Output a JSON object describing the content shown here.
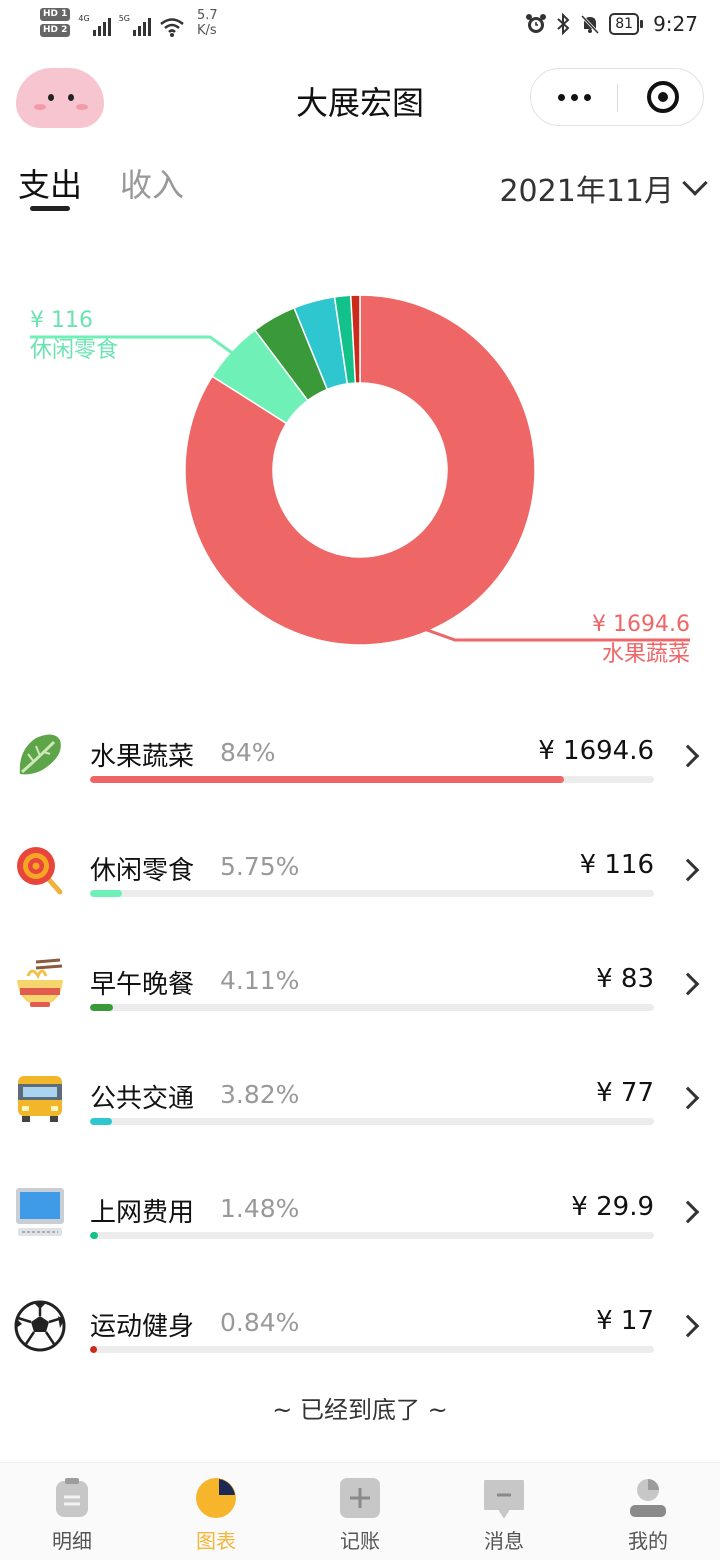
{
  "status_bar": {
    "sim1": "HD 1",
    "sim2": "HD 2",
    "net1": "4G",
    "net2": "5G",
    "speed_value": "5.7",
    "speed_unit": "K/s",
    "battery": "81",
    "time": "9:27"
  },
  "header": {
    "title": "大展宏图"
  },
  "tabs": [
    {
      "label": "支出",
      "active": true
    },
    {
      "label": "收入",
      "active": false
    }
  ],
  "month": "2021年11月",
  "chart_data": {
    "type": "pie",
    "style": "donut",
    "categories": [
      "水果蔬菜",
      "休闲零食",
      "早午晚餐",
      "公共交通",
      "上网费用",
      "运动健身"
    ],
    "values": [
      1694.6,
      116,
      83,
      77,
      29.9,
      17
    ],
    "colors": [
      "#ee6666",
      "#6ff0b6",
      "#3a9a3a",
      "#2ec7cf",
      "#12c28a",
      "#cc2a1a"
    ],
    "callouts": [
      {
        "amount": "¥ 116",
        "label": "休闲零食"
      },
      {
        "amount": "¥ 1694.6",
        "label": "水果蔬菜"
      }
    ]
  },
  "categories": [
    {
      "name": "水果蔬菜",
      "percent": "84%",
      "amount": "¥ 1694.6",
      "ratio": 0.84,
      "color": "#ee6666",
      "icon": "lettuce-icon"
    },
    {
      "name": "休闲零食",
      "percent": "5.75%",
      "amount": "¥ 116",
      "ratio": 0.0575,
      "color": "#6ff0b6",
      "icon": "lollipop-icon"
    },
    {
      "name": "早午晚餐",
      "percent": "4.11%",
      "amount": "¥ 83",
      "ratio": 0.0411,
      "color": "#3a9a3a",
      "icon": "noodle-bowl-icon"
    },
    {
      "name": "公共交通",
      "percent": "3.82%",
      "amount": "¥ 77",
      "ratio": 0.0382,
      "color": "#2ec7cf",
      "icon": "bus-icon"
    },
    {
      "name": "上网费用",
      "percent": "1.48%",
      "amount": "¥ 29.9",
      "ratio": 0.0148,
      "color": "#12c28a",
      "icon": "computer-icon"
    },
    {
      "name": "运动健身",
      "percent": "0.84%",
      "amount": "¥ 17",
      "ratio": 0.0084,
      "color": "#cc2a1a",
      "icon": "soccer-ball-icon"
    }
  ],
  "end_note": "~ 已经到底了 ~",
  "bottom_nav": [
    {
      "label": "明细",
      "icon": "detail-icon",
      "active": false
    },
    {
      "label": "图表",
      "icon": "pie-chart-icon",
      "active": true
    },
    {
      "label": "记账",
      "icon": "add-icon",
      "active": false
    },
    {
      "label": "消息",
      "icon": "message-icon",
      "active": false
    },
    {
      "label": "我的",
      "icon": "profile-icon",
      "active": false
    }
  ]
}
